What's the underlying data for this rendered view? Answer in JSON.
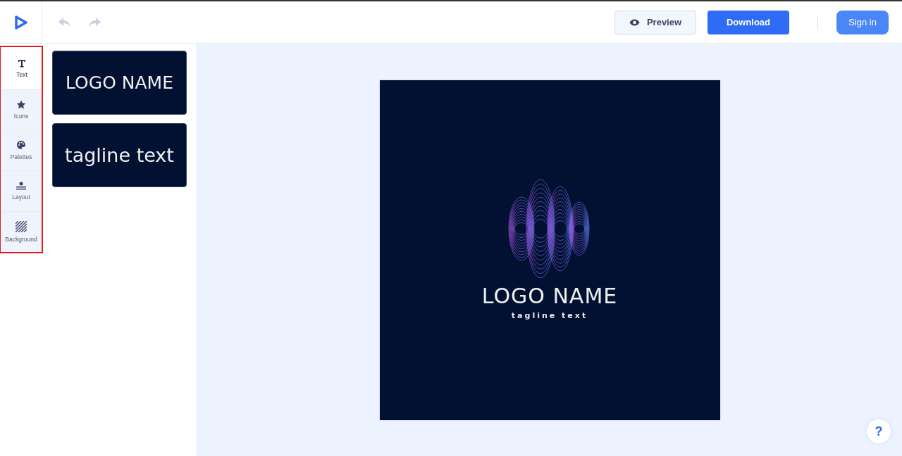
{
  "toolbar": {
    "buttons": [
      {
        "label": "Preview",
        "kind": "preview"
      },
      {
        "label": "Download",
        "kind": "download"
      },
      {
        "label": "Sign in",
        "kind": "signin"
      }
    ]
  },
  "sidebar": {
    "items": [
      {
        "label": "Text",
        "kind": "text",
        "selected": true
      },
      {
        "label": "Icons",
        "kind": "icons",
        "selected": false
      },
      {
        "label": "Palettes",
        "kind": "palettes",
        "selected": false
      },
      {
        "label": "Layout",
        "kind": "layout",
        "selected": false
      },
      {
        "label": "Background",
        "kind": "background",
        "selected": false
      }
    ]
  },
  "panel": {
    "items": [
      {
        "label": "LOGO NAME"
      },
      {
        "label": "tagline text"
      }
    ]
  },
  "canvas": {
    "logo_name": "LOGO NAME",
    "tagline": "tagline text"
  },
  "help": {
    "label": "?"
  }
}
